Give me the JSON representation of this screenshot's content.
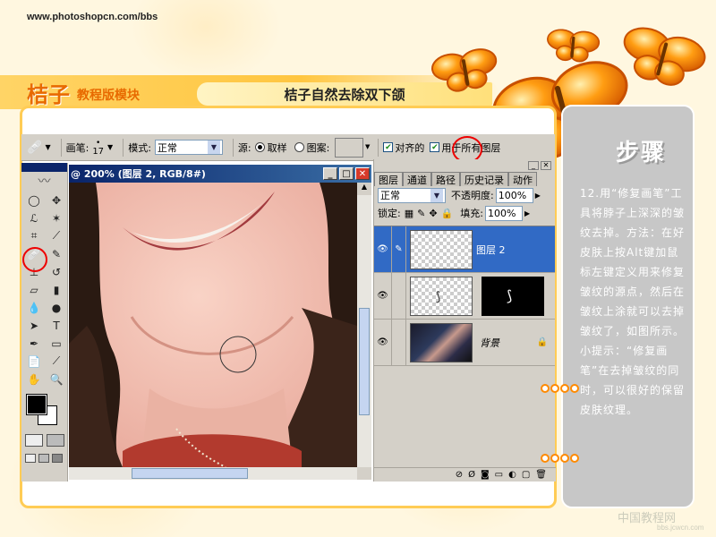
{
  "site": {
    "url": "www.photoshopcn.com/bbs"
  },
  "brand": {
    "name": "桔子",
    "subtitle": "教程版模块"
  },
  "header": {
    "title": "桔子自然去除双下颌"
  },
  "sidebar": {
    "heading": "步骤",
    "step_text": "12.用“修复画笔”工具将脖子上深深的皱纹去掉。方法：在好皮肤上按Alt键加鼠标左键定义用来修复皱纹的源点，然后在皱纹上涂就可以去掉皱纹了，如图所示。",
    "tip_text": "小提示：“修复画笔”在去掉皱纹的同时，可以很好的保留皮肤纹理。"
  },
  "options_bar": {
    "brush_label": "画笔:",
    "brush_size": "17",
    "mode_label": "模式:",
    "mode_value": "正常",
    "source_label": "源:",
    "sampled_label": "取样",
    "pattern_label": "图案:",
    "aligned_label": "对齐的",
    "all_layers_label": "用于所有图层"
  },
  "document": {
    "title": "@ 200% (图层 2, RGB/8#)"
  },
  "layers_panel": {
    "tabs": [
      "图层",
      "通道",
      "路径",
      "历史记录",
      "动作"
    ],
    "blend_mode": "正常",
    "opacity_label": "不透明度:",
    "opacity_value": "100%",
    "lock_label": "锁定:",
    "fill_label": "填充:",
    "fill_value": "100%",
    "layers": [
      {
        "name": "图层 2",
        "selected": true
      },
      {
        "name": "",
        "selected": false
      },
      {
        "name": "背景",
        "selected": false
      }
    ]
  },
  "watermark": {
    "text": "中国教程网",
    "url": "bbs.jcwcn.com"
  },
  "colors": {
    "accent": "#ff8a00",
    "brand": "#e86a00",
    "panel_gray": "#c7c7c7"
  }
}
